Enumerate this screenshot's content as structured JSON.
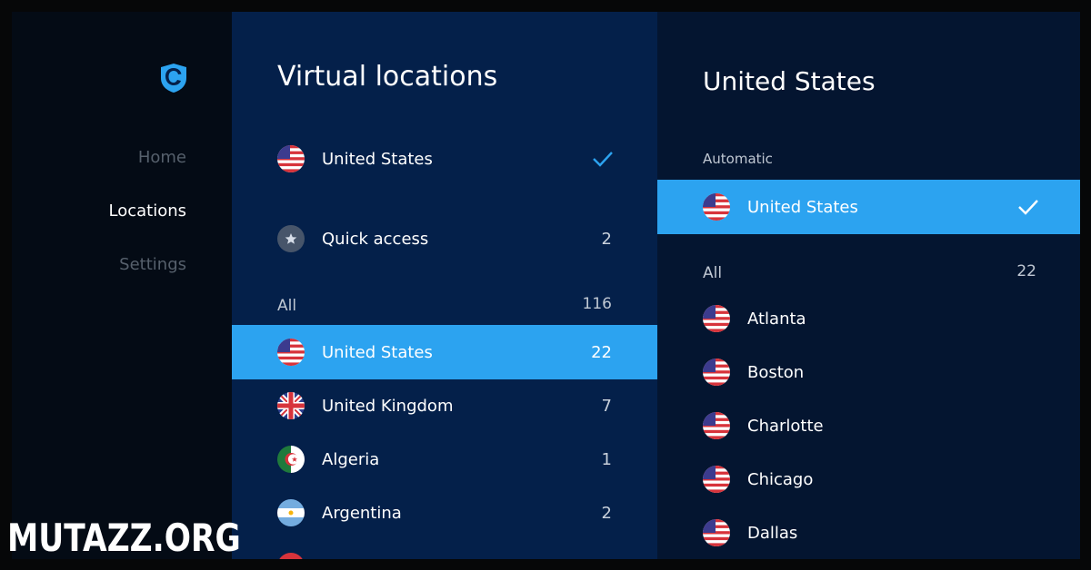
{
  "sidebar": {
    "nav": [
      {
        "label": "Home",
        "active": false
      },
      {
        "label": "Locations",
        "active": true
      },
      {
        "label": "Settings",
        "active": false
      }
    ],
    "logo_icon": "shield-logo-icon"
  },
  "locations_panel": {
    "title": "Virtual locations",
    "current": {
      "label": "United States",
      "flag": "us"
    },
    "quick_access": {
      "label": "Quick access",
      "count": "2"
    },
    "all_label": "All",
    "all_count": "116",
    "countries": [
      {
        "label": "United States",
        "count": "22",
        "flag": "us",
        "selected": true
      },
      {
        "label": "United Kingdom",
        "count": "7",
        "flag": "uk",
        "selected": false
      },
      {
        "label": "Algeria",
        "count": "1",
        "flag": "dz",
        "selected": false
      },
      {
        "label": "Argentina",
        "count": "2",
        "flag": "ar",
        "selected": false
      }
    ]
  },
  "detail_panel": {
    "title": "United States",
    "automatic_label": "Automatic",
    "automatic_item": {
      "label": "United States",
      "flag": "us",
      "selected": true
    },
    "all_label": "All",
    "all_count": "22",
    "cities": [
      {
        "label": "Atlanta",
        "flag": "us"
      },
      {
        "label": "Boston",
        "flag": "us"
      },
      {
        "label": "Charlotte",
        "flag": "us"
      },
      {
        "label": "Chicago",
        "flag": "us"
      },
      {
        "label": "Dallas",
        "flag": "us"
      }
    ]
  },
  "watermark": "MUTAZZ.ORG",
  "colors": {
    "sidebar_bg": "#040b15",
    "mid_panel_bg": "#04204a",
    "right_panel_bg": "#041530",
    "accent": "#2ca3f0",
    "check_blue": "#2ca3f0"
  }
}
